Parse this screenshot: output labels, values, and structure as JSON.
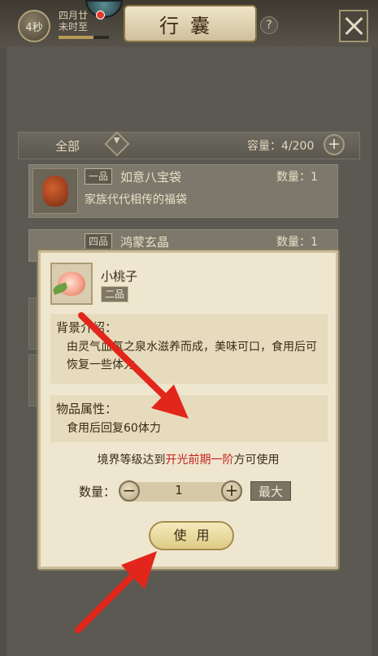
{
  "topbar": {
    "timer": "4秒",
    "month_text": "四月廿",
    "hour_text": "未时至",
    "time_progress": 0.7,
    "title": "行囊",
    "help_icon": "question-icon",
    "close_icon": "close-icon"
  },
  "filter": {
    "tab_label": "全部",
    "capacity_text": "容量：4/200"
  },
  "items": [
    {
      "grade": "一品",
      "name": "如意八宝袋",
      "qty": "数量：1",
      "desc": "家族代代相传的福袋"
    },
    {
      "grade": "四品",
      "name": "鸿蒙玄晶",
      "qty": "数量：1"
    }
  ],
  "popup": {
    "name": "小桃子",
    "grade": "二品",
    "background_title": "背景介绍：",
    "background_text": "由灵气血氛之泉水滋养而成，美味可口，食用后可恢复一些体力",
    "attr_title": "物品属性：",
    "attr_text": "食用后回复60体力",
    "req_before": "境界等级达到",
    "req_highlight": "开光前期一阶",
    "req_after": "方可使用",
    "qty_label": "数量：",
    "qty_value": "1",
    "max_label": "最大",
    "use_label": "使用"
  },
  "colors": {
    "arrow": "#e3261c",
    "highlight": "#c4231b"
  }
}
